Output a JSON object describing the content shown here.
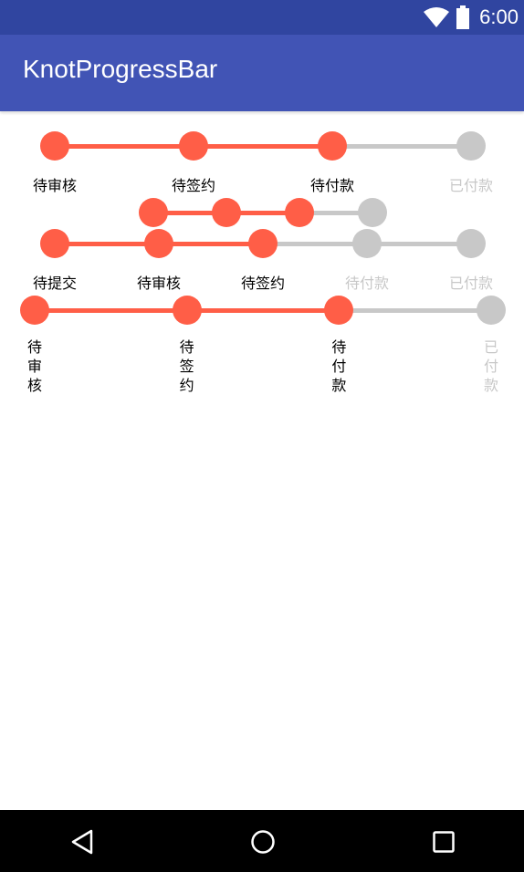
{
  "status_bar": {
    "time": "6:00",
    "icons": [
      "wifi-icon",
      "battery-icon"
    ]
  },
  "app_bar": {
    "title": "KnotProgressBar"
  },
  "colors": {
    "active": "#ff5e47",
    "inactive": "#c8c8c8",
    "label_active": "#000000",
    "label_inactive": "#c8c8c8",
    "app_bar": "#4154b5",
    "status_bar": "#3045a0"
  },
  "progress_bars": [
    {
      "name": "review-sign-pay",
      "knot_count": 4,
      "reached_count": 3,
      "labels": [
        "待审核",
        "待签约",
        "待付款",
        "已付款"
      ],
      "orientation_of_labels": "horizontal"
    },
    {
      "name": "compact-no-labels",
      "knot_count": 4,
      "reached_count": 3,
      "labels": [],
      "orientation_of_labels": "none"
    },
    {
      "name": "submit-review-sign-pay",
      "knot_count": 5,
      "reached_count": 3,
      "labels": [
        "待提交",
        "待审核",
        "待签约",
        "待付款",
        "已付款"
      ],
      "orientation_of_labels": "horizontal"
    },
    {
      "name": "vertical-labels",
      "knot_count": 4,
      "reached_count": 3,
      "labels": [
        "待审核",
        "待签约",
        "待付款",
        "已付款"
      ],
      "orientation_of_labels": "vertical"
    }
  ],
  "nav_bar": {
    "buttons": [
      "back-icon",
      "home-icon",
      "recents-icon"
    ]
  }
}
